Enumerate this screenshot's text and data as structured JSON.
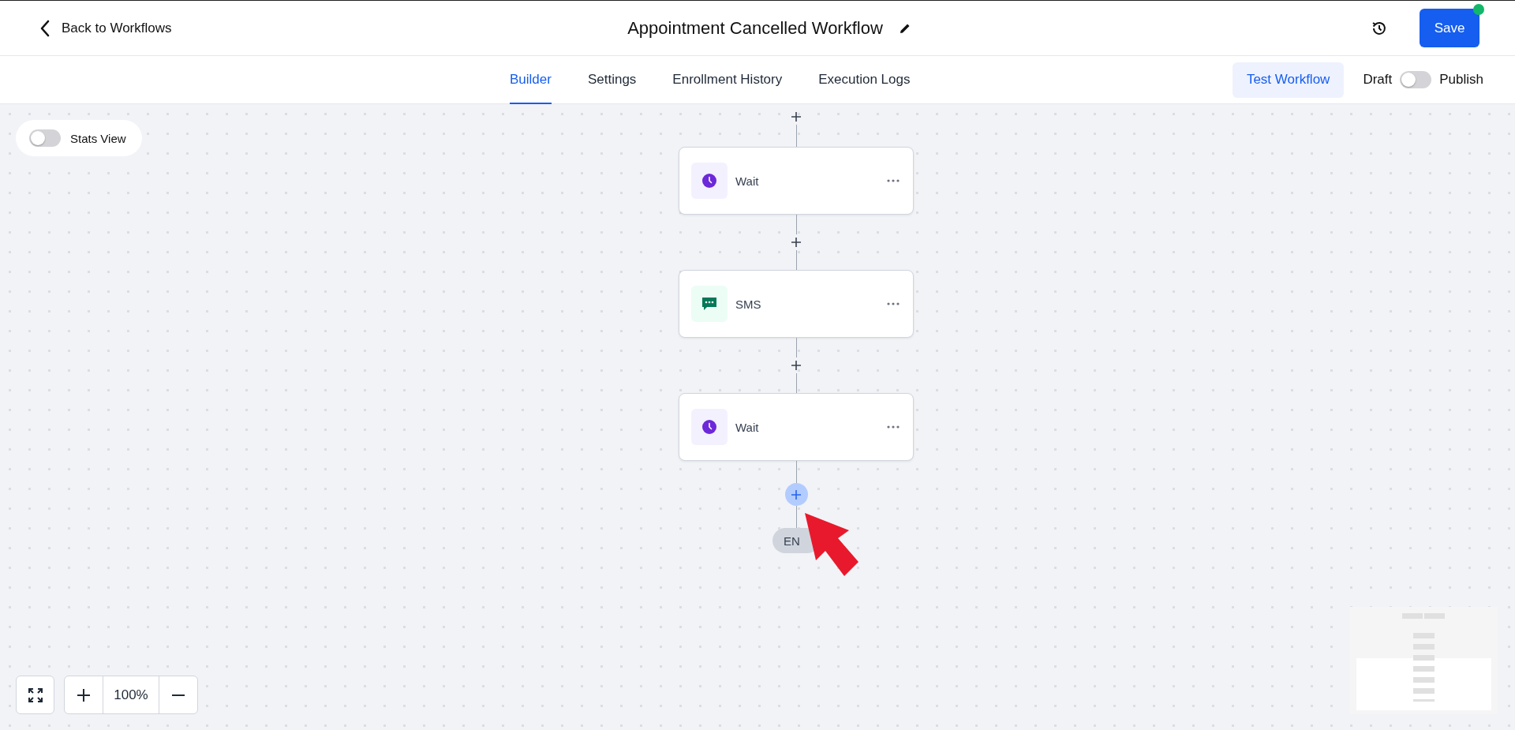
{
  "header": {
    "back_link": "Back to Workflows",
    "title": "Appointment Cancelled Workflow",
    "save_button": "Save",
    "unsaved": true
  },
  "tabs": [
    {
      "label": "Builder",
      "selected": true
    },
    {
      "label": "Settings",
      "selected": false
    },
    {
      "label": "Enrollment History",
      "selected": false
    },
    {
      "label": "Execution Logs",
      "selected": false
    }
  ],
  "test_button": "Test Workflow",
  "publish_toggle": {
    "off_label": "Draft",
    "on_label": "Publish",
    "on": false
  },
  "stats_view": {
    "label": "Stats View",
    "on": false
  },
  "steps": [
    {
      "kind": "wait",
      "label": "Wait"
    },
    {
      "kind": "sms",
      "label": "SMS"
    },
    {
      "kind": "wait",
      "label": "Wait"
    }
  ],
  "end_label": "EN",
  "zoom": {
    "level": "100%"
  }
}
